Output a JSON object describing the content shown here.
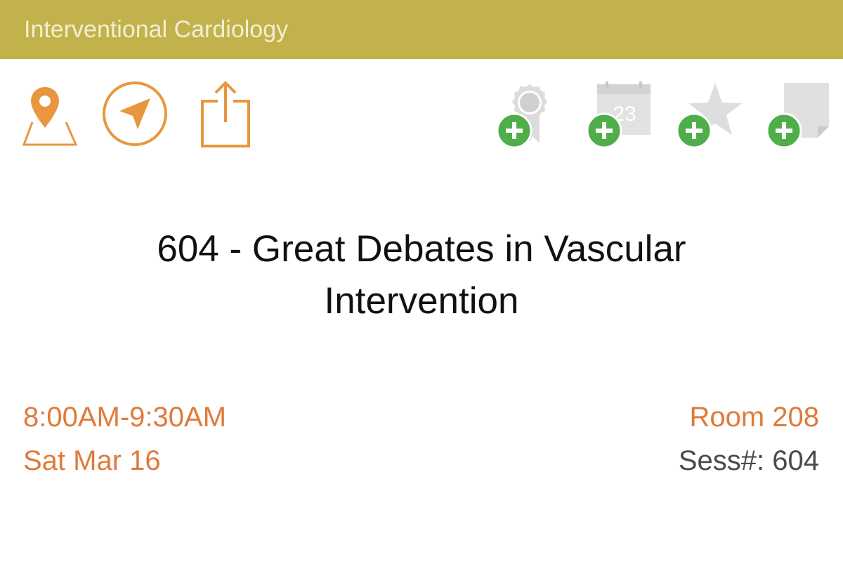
{
  "header": {
    "track": "Interventional Cardiology",
    "background_color": "#c2b24b"
  },
  "actions_left": [
    {
      "name": "map-icon"
    },
    {
      "name": "navigate-icon"
    },
    {
      "name": "share-icon"
    }
  ],
  "actions_right": [
    {
      "name": "add-award-button",
      "icon": "ribbon-award-icon",
      "badge": "plus-badge-icon"
    },
    {
      "name": "add-calendar-button",
      "icon": "calendar-icon",
      "calendar_day": "23",
      "badge": "plus-badge-icon"
    },
    {
      "name": "add-favorite-button",
      "icon": "star-icon",
      "badge": "plus-badge-icon"
    },
    {
      "name": "add-note-button",
      "icon": "note-icon",
      "badge": "plus-badge-icon"
    }
  ],
  "session": {
    "title": "604 - Great Debates in Vascular Intervention",
    "time": "8:00AM-9:30AM",
    "date": "Sat Mar 16",
    "room": "Room 208",
    "session_number": "Sess#: 604"
  },
  "colors": {
    "accent_orange": "#e8973e",
    "text_orange": "#e07a3a",
    "plus_green": "#4fae4a",
    "disabled_grey": "#d4d4d4"
  }
}
